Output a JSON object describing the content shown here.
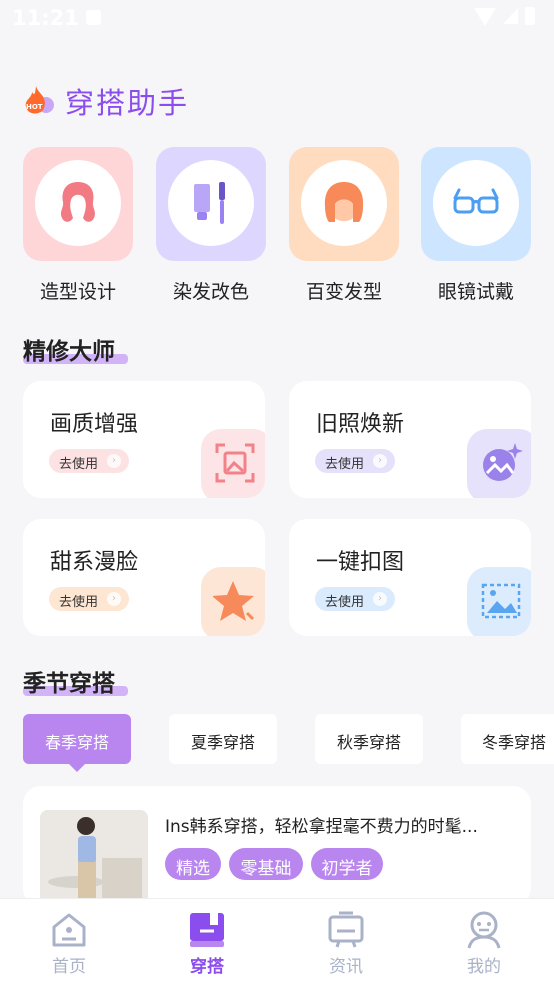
{
  "status": {
    "time": "11:21"
  },
  "header": {
    "title": "穿搭助手",
    "hot_badge": "HOT"
  },
  "tools": [
    {
      "label": "造型设计",
      "icon": "hair-style-icon",
      "bg": "#ffd6d8",
      "fg": "#f27a82"
    },
    {
      "label": "染发改色",
      "icon": "dye-tools-icon",
      "bg": "#ddd6ff",
      "fg": "#9b82f2"
    },
    {
      "label": "百变发型",
      "icon": "hairstyle-face-icon",
      "bg": "#ffdcc0",
      "fg": "#f78a58"
    },
    {
      "label": "眼镜试戴",
      "icon": "glasses-icon",
      "bg": "#cde5ff",
      "fg": "#4b9ef2"
    }
  ],
  "retouch": {
    "title": "精修大师",
    "use_label": "去使用",
    "items": [
      {
        "title": "画质增强",
        "icon": "image-enhance-icon",
        "pill_bg": "#fde2e4",
        "icon_bg": "#fde4e6",
        "fg": "#f2828a"
      },
      {
        "title": "旧照焕新",
        "icon": "photo-sparkle-icon",
        "pill_bg": "#e5e1fb",
        "icon_bg": "#e7e2fb",
        "fg": "#9b82ea"
      },
      {
        "title": "甜系漫脸",
        "icon": "star-icon",
        "pill_bg": "#fde6d2",
        "icon_bg": "#fde6d5",
        "fg": "#f68a5a"
      },
      {
        "title": "一键扣图",
        "icon": "crop-image-icon",
        "pill_bg": "#d9ebfd",
        "icon_bg": "#dcecfd",
        "fg": "#5aa5f0"
      }
    ]
  },
  "season": {
    "title": "季节穿搭",
    "tabs": [
      "春季穿搭",
      "夏季穿搭",
      "秋季穿搭",
      "冬季穿搭"
    ],
    "active_tab": 0
  },
  "article": {
    "title": "Ins韩系穿搭，轻松拿捏毫不费力的时髦...",
    "tags": [
      "精选",
      "零基础",
      "初学者"
    ]
  },
  "tabbar": {
    "items": [
      {
        "label": "首页",
        "icon": "home-icon"
      },
      {
        "label": "穿搭",
        "icon": "outfit-book-icon"
      },
      {
        "label": "资讯",
        "icon": "news-board-icon"
      },
      {
        "label": "我的",
        "icon": "profile-icon"
      }
    ],
    "active": 1
  },
  "colors": {
    "accent": "#8c4dee",
    "tag": "#b986f0",
    "background": "#f6f6f8"
  }
}
